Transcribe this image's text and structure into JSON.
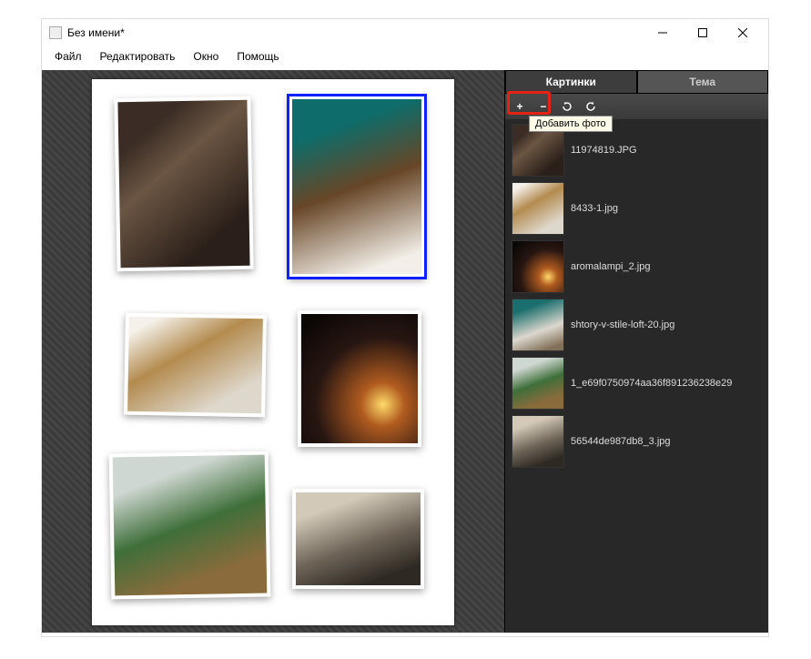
{
  "window": {
    "title": "Без имени*"
  },
  "menu": {
    "file": "Файл",
    "edit": "Редактировать",
    "window": "Окно",
    "help": "Помощь"
  },
  "tabs": {
    "pictures": "Картинки",
    "theme": "Тема"
  },
  "toolbar": {
    "add_tooltip": "Добавить фото"
  },
  "images": [
    {
      "name": "11974819.JPG"
    },
    {
      "name": "8433-1.jpg"
    },
    {
      "name": "aromalampi_2.jpg"
    },
    {
      "name": "shtory-v-stile-loft-20.jpg"
    },
    {
      "name": "1_e69f0750974aa36f891236238e29"
    },
    {
      "name": "56544de987db8_3.jpg"
    }
  ]
}
